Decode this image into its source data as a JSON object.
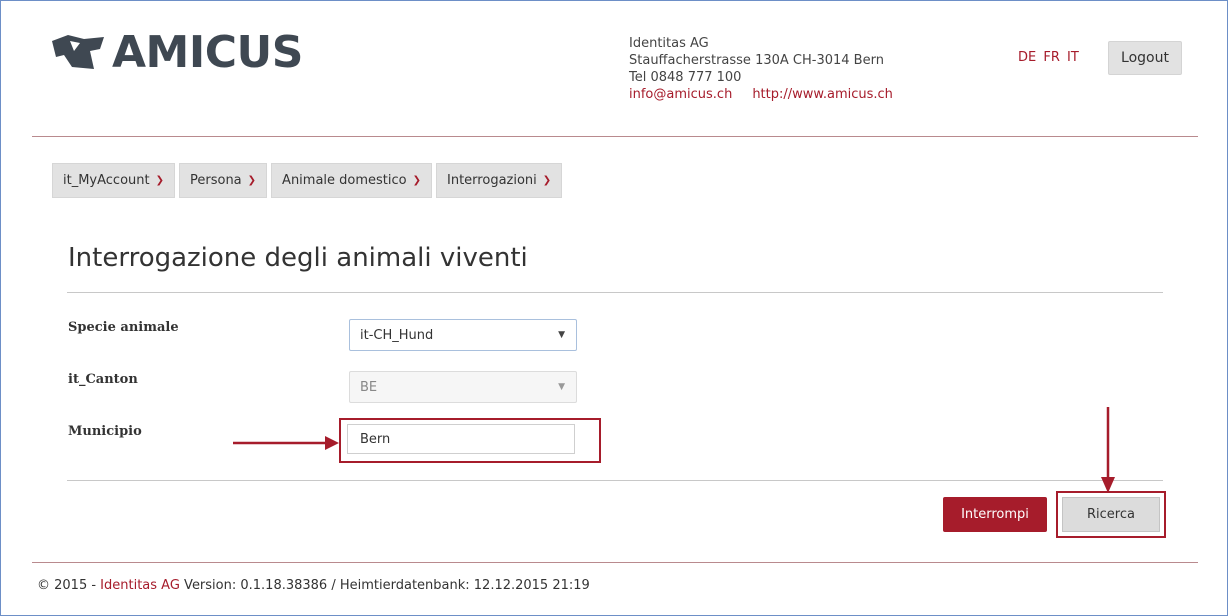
{
  "brand": {
    "name": "AMICUS"
  },
  "company": {
    "name": "Identitas AG",
    "address": "Stauffacherstrasse 130A CH-3014 Bern",
    "phone": "Tel 0848 777 100",
    "email": "info@amicus.ch",
    "website": "http://www.amicus.ch"
  },
  "languages": [
    "DE",
    "FR",
    "IT"
  ],
  "logout_label": "Logout",
  "nav": {
    "items": [
      {
        "label": "it_MyAccount"
      },
      {
        "label": "Persona"
      },
      {
        "label": "Animale domestico"
      },
      {
        "label": "Interrogazioni"
      }
    ]
  },
  "page_title": "Interrogazione degli animali viventi",
  "form": {
    "species": {
      "label": "Specie animale",
      "value": "it-CH_Hund"
    },
    "canton": {
      "label": "it_Canton",
      "value": "BE"
    },
    "municipality": {
      "label": "Municipio",
      "value": "Bern"
    }
  },
  "buttons": {
    "cancel": "Interrompi",
    "search": "Ricerca"
  },
  "footer": {
    "prefix": "© 2015 - ",
    "company": "Identitas AG",
    "suffix": " Version: 0.1.18.38386 / Heimtierdatenbank: 12.12.2015 21:19"
  },
  "colors": {
    "accent": "#a61c2b",
    "button_grey": "#e2e2e2",
    "logo": "#3f4852"
  },
  "icons": {
    "logo": "dog-head-logo-icon",
    "dropdown": "chevron-down-icon",
    "select_caret": "caret-down-icon",
    "annotation": "arrow-icon"
  }
}
